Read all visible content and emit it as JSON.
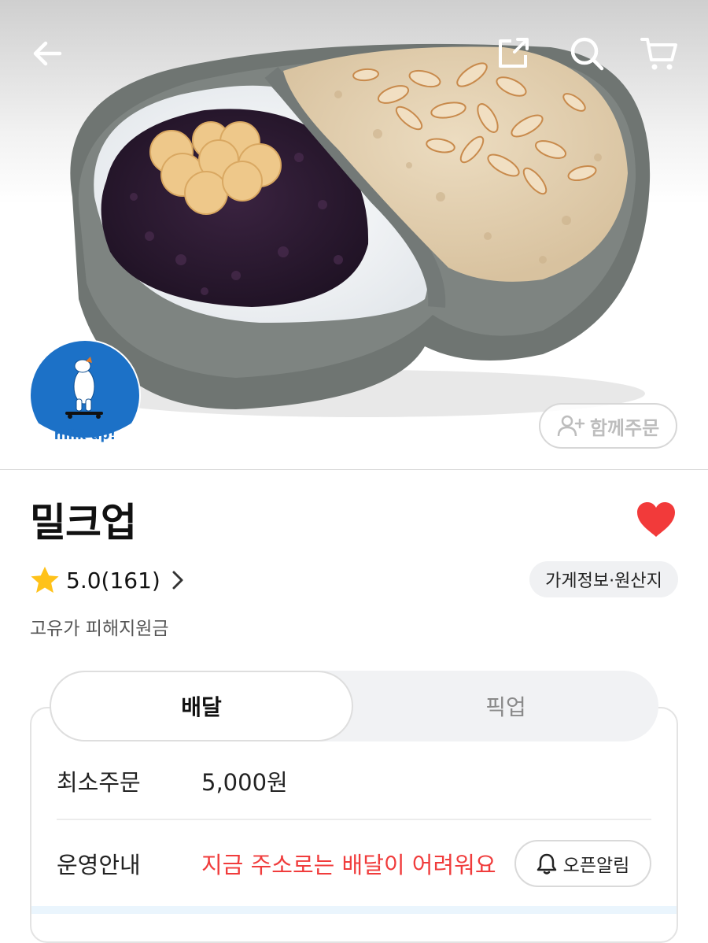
{
  "hero": {
    "logo_text": "milk up!",
    "together_order_label": "함께주문"
  },
  "store": {
    "name": "밀크업",
    "rating": "5.0(161)",
    "info_chip_label": "가게정보·원산지",
    "subtitle": "고유가 피해지원금",
    "favorited": true
  },
  "order": {
    "tabs": [
      {
        "label": "배달",
        "active": true
      },
      {
        "label": "픽업",
        "active": false
      }
    ],
    "min_order_label": "최소주문",
    "min_order_value": "5,000원",
    "operation_label": "운영안내",
    "operation_value": "지금 주소로는 배달이 어려워요",
    "open_alarm_label": "오픈알림"
  },
  "colors": {
    "alert_red": "#f03c3c",
    "heart_red": "#f23a3a",
    "star_yellow": "#ffc21a",
    "logo_blue": "#1c71c7"
  },
  "icons": [
    "back-arrow-icon",
    "share-icon",
    "search-icon",
    "cart-icon",
    "heart-icon",
    "star-icon",
    "chevron-right-icon",
    "person-add-icon",
    "bell-icon"
  ]
}
